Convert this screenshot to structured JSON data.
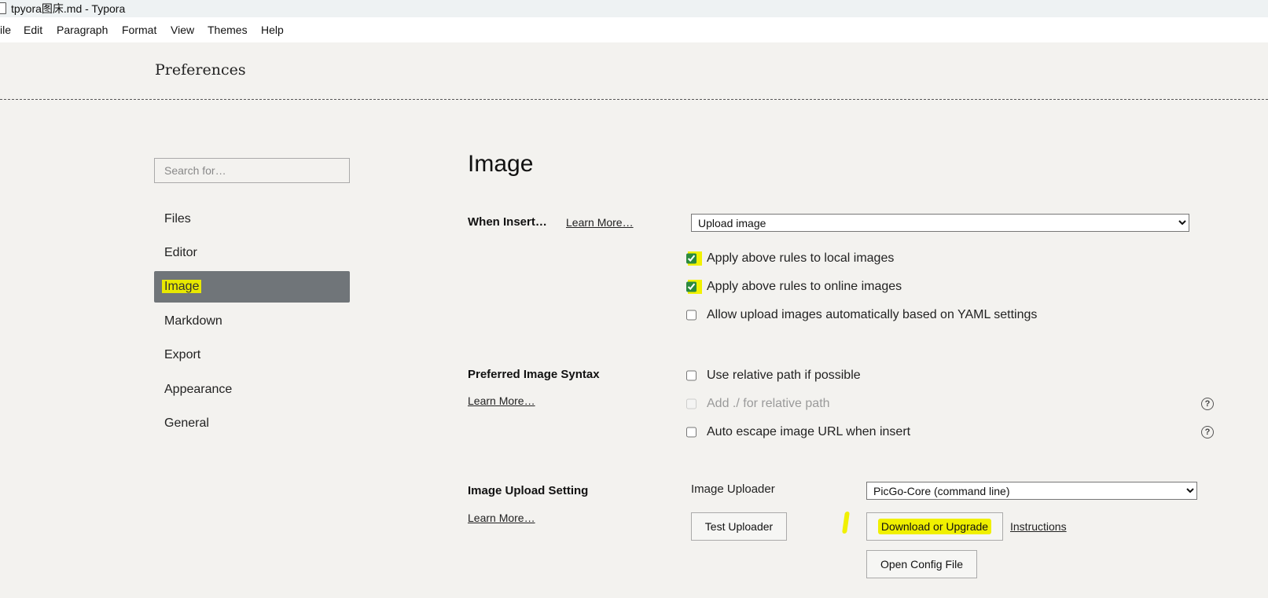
{
  "window": {
    "title": "tpyora图床.md - Typora"
  },
  "menu": [
    "ile",
    "Edit",
    "Paragraph",
    "Format",
    "View",
    "Themes",
    "Help"
  ],
  "preferences_title": "Preferences",
  "search": {
    "placeholder": "Search for…"
  },
  "nav": {
    "items": [
      "Files",
      "Editor",
      "Image",
      "Markdown",
      "Export",
      "Appearance",
      "General"
    ],
    "active": "Image"
  },
  "section": {
    "title": "Image"
  },
  "when_insert": {
    "label": "When Insert…",
    "learn_more": "Learn More…",
    "selected": "Upload image",
    "options": [
      {
        "label": "Apply above rules to local images",
        "checked": true
      },
      {
        "label": "Apply above rules to online images",
        "checked": true
      },
      {
        "label": "Allow upload images automatically based on YAML settings",
        "checked": false
      }
    ]
  },
  "syntax": {
    "label": "Preferred Image Syntax",
    "learn_more": "Learn More…",
    "options": [
      {
        "label": "Use relative path if possible",
        "checked": false,
        "disabled": false,
        "help": false
      },
      {
        "label": "Add ./ for relative path",
        "checked": false,
        "disabled": true,
        "help": true
      },
      {
        "label": "Auto escape image URL when insert",
        "checked": false,
        "disabled": false,
        "help": true
      }
    ],
    "help_glyph": "?"
  },
  "upload": {
    "label": "Image Upload Setting",
    "learn_more": "Learn More…",
    "uploader_label": "Image Uploader",
    "uploader_selected": "PicGo-Core (command line)",
    "test_button": "Test Uploader",
    "download_button": "Download or Upgrade",
    "instructions_link": "Instructions",
    "open_config_button": "Open Config File"
  },
  "colors": {
    "highlight": "#f0f000",
    "nav_active_bg": "#707579",
    "background": "#f3f2ef"
  }
}
